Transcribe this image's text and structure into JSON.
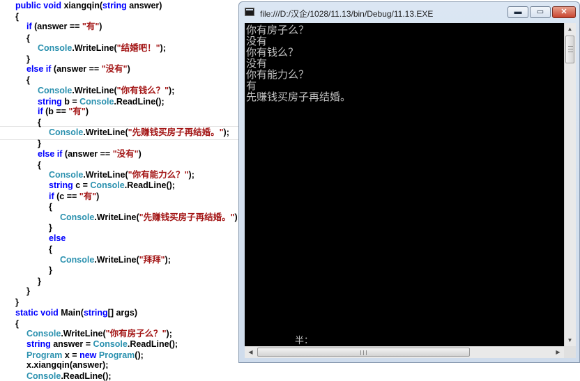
{
  "editor": {
    "lines": [
      [
        {
          "t": "public void ",
          "c": "kw"
        },
        {
          "t": "xiangqin(",
          "c": "tx"
        },
        {
          "t": "string",
          "c": "kw"
        },
        {
          "t": " answer)",
          "c": "tx"
        }
      ],
      [
        {
          "t": "{",
          "c": "tx"
        }
      ],
      [
        {
          "t": "if",
          "c": "kw"
        },
        {
          "t": " (answer == ",
          "c": "tx"
        },
        {
          "t": "\"有\"",
          "c": "st"
        },
        {
          "t": ")",
          "c": "tx"
        }
      ],
      [
        {
          "t": "{",
          "c": "tx"
        }
      ],
      [
        {
          "t": "Console",
          "c": "ty"
        },
        {
          "t": ".WriteLine(",
          "c": "tx"
        },
        {
          "t": "\"结婚吧！\"",
          "c": "st"
        },
        {
          "t": ");",
          "c": "tx"
        }
      ],
      [
        {
          "t": "}",
          "c": "tx"
        }
      ],
      [
        {
          "t": "else if",
          "c": "kw"
        },
        {
          "t": " (answer == ",
          "c": "tx"
        },
        {
          "t": "\"没有\"",
          "c": "st"
        },
        {
          "t": ")",
          "c": "tx"
        }
      ],
      [
        {
          "t": "{",
          "c": "tx"
        }
      ],
      [
        {
          "t": "Console",
          "c": "ty"
        },
        {
          "t": ".WriteLine(",
          "c": "tx"
        },
        {
          "t": "\"你有钱么？\"",
          "c": "st"
        },
        {
          "t": ");",
          "c": "tx"
        }
      ],
      [
        {
          "t": "string",
          "c": "kw"
        },
        {
          "t": " b = ",
          "c": "tx"
        },
        {
          "t": "Console",
          "c": "ty"
        },
        {
          "t": ".ReadLine();",
          "c": "tx"
        }
      ],
      [
        {
          "t": "if",
          "c": "kw"
        },
        {
          "t": " (b == ",
          "c": "tx"
        },
        {
          "t": "\"有\"",
          "c": "st"
        },
        {
          "t": ")",
          "c": "tx"
        }
      ],
      [
        {
          "t": "{",
          "c": "tx"
        }
      ],
      [
        {
          "t": "Console",
          "c": "ty"
        },
        {
          "t": ".WriteLine(",
          "c": "tx"
        },
        {
          "t": "\"先赚钱买房子再结婚。\"",
          "c": "st"
        },
        {
          "t": ");",
          "c": "tx"
        }
      ],
      [
        {
          "t": "}",
          "c": "tx"
        }
      ],
      [
        {
          "t": "else if",
          "c": "kw"
        },
        {
          "t": " (answer == ",
          "c": "tx"
        },
        {
          "t": "\"没有\"",
          "c": "st"
        },
        {
          "t": ")",
          "c": "tx"
        }
      ],
      [
        {
          "t": "{",
          "c": "tx"
        }
      ],
      [
        {
          "t": "Console",
          "c": "ty"
        },
        {
          "t": ".WriteLine(",
          "c": "tx"
        },
        {
          "t": "\"你有能力么？\"",
          "c": "st"
        },
        {
          "t": ");",
          "c": "tx"
        }
      ],
      [
        {
          "t": "string",
          "c": "kw"
        },
        {
          "t": " c = ",
          "c": "tx"
        },
        {
          "t": "Console",
          "c": "ty"
        },
        {
          "t": ".ReadLine();",
          "c": "tx"
        }
      ],
      [
        {
          "t": "if",
          "c": "kw"
        },
        {
          "t": " (c == ",
          "c": "tx"
        },
        {
          "t": "\"有\"",
          "c": "st"
        },
        {
          "t": ")",
          "c": "tx"
        }
      ],
      [
        {
          "t": "{",
          "c": "tx"
        }
      ],
      [
        {
          "t": "Console",
          "c": "ty"
        },
        {
          "t": ".WriteLine(",
          "c": "tx"
        },
        {
          "t": "\"先赚钱买房子再结婚。\"",
          "c": "st"
        },
        {
          "t": ");",
          "c": "tx"
        }
      ],
      [
        {
          "t": "}",
          "c": "tx"
        }
      ],
      [
        {
          "t": "else",
          "c": "kw"
        }
      ],
      [
        {
          "t": "{",
          "c": "tx"
        }
      ],
      [
        {
          "t": "Console",
          "c": "ty"
        },
        {
          "t": ".WriteLine(",
          "c": "tx"
        },
        {
          "t": "\"拜拜\"",
          "c": "st"
        },
        {
          "t": ");",
          "c": "tx"
        }
      ],
      [
        {
          "t": "}",
          "c": "tx"
        }
      ],
      [
        {
          "t": "}",
          "c": "tx"
        }
      ],
      [
        {
          "t": "}",
          "c": "tx"
        }
      ],
      [
        {
          "t": "}",
          "c": "tx"
        }
      ],
      [
        {
          "t": "static void ",
          "c": "kw"
        },
        {
          "t": "Main(",
          "c": "tx"
        },
        {
          "t": "string",
          "c": "kw"
        },
        {
          "t": "[] args)",
          "c": "tx"
        }
      ],
      [
        {
          "t": "{",
          "c": "tx"
        }
      ],
      [
        {
          "t": "Console",
          "c": "ty"
        },
        {
          "t": ".WriteLine(",
          "c": "tx"
        },
        {
          "t": "\"你有房子么？\"",
          "c": "st"
        },
        {
          "t": ");",
          "c": "tx"
        }
      ],
      [
        {
          "t": "string",
          "c": "kw"
        },
        {
          "t": " answer = ",
          "c": "tx"
        },
        {
          "t": "Console",
          "c": "ty"
        },
        {
          "t": ".ReadLine();",
          "c": "tx"
        }
      ],
      [
        {
          "t": "Program",
          "c": "ty"
        },
        {
          "t": " x = ",
          "c": "tx"
        },
        {
          "t": "new",
          "c": "kw"
        },
        {
          "t": " ",
          "c": "tx"
        },
        {
          "t": "Program",
          "c": "ty"
        },
        {
          "t": "();",
          "c": "tx"
        }
      ],
      [
        {
          "t": "x.xiangqin(answer);",
          "c": "tx"
        }
      ],
      [
        {
          "t": "Console",
          "c": "ty"
        },
        {
          "t": ".ReadLine();",
          "c": "tx"
        }
      ]
    ]
  },
  "window": {
    "title": "file:///D:/汉企/1028/11.13/bin/Debug/11.13.EXE",
    "close_label": "✕",
    "minimize_label": "▬",
    "maximize_label": "▭"
  },
  "console": {
    "lines": [
      "你有房子么？",
      "没有",
      "你有钱么？",
      "没有",
      "你有能力么？",
      "有",
      "先赚钱买房子再结婚。"
    ],
    "ime_status": "半："
  },
  "icons": {
    "app": "console-app-icon",
    "scroll_up": "chevron-up-icon",
    "scroll_down": "chevron-down-icon",
    "scroll_left": "chevron-left-icon",
    "scroll_right": "chevron-right-icon"
  },
  "colors": {
    "keyword": "#0000ff",
    "type": "#2b91af",
    "string": "#a31515",
    "console_bg": "#000000",
    "console_text": "#c0c0c0"
  }
}
